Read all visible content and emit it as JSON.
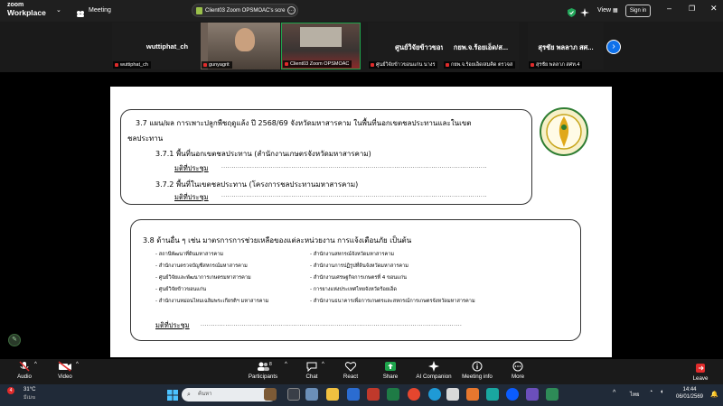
{
  "app": {
    "brand_top": "zoom",
    "brand_bottom": "Workplace"
  },
  "titlebar": {
    "meeting_label": "Meeting",
    "tab_label": "Client03 Zoom OPSMOAC's scre",
    "view_label": "View",
    "signin_label": "Sign in"
  },
  "gallery": {
    "tiles": [
      {
        "name": "wuttiphat_ch",
        "label": "wuttiphat_ch"
      },
      {
        "name": "",
        "label": "gunyagrit"
      },
      {
        "name": "",
        "label": "Client03 Zoom OPSMOAC"
      },
      {
        "name": "ศูนย์วิจัยข้าวขอน...",
        "label": "ศูนย์วิจัยข้าวขอนแก่น นางร"
      },
      {
        "name": "กยพ.จ.ร้อยเอ็ด/ส...",
        "label": "กยพ.จ.ร้อยเอ็ด/สมคิด ตรวจส"
      },
      {
        "name": "สุรชัย พลลาภ สศ...",
        "label": "สุรชัย พลลาภ สศท.4"
      }
    ]
  },
  "slide": {
    "box1": {
      "heading_line1": "3.7 แผน/ผล การเพาะปลูกพืชฤดูแล้ง ปี 2568/69 จังหวัดมหาสารคาม ในพื้นที่นอกเขตชลประทานและในเขต",
      "heading_line2": "ชลประทาน",
      "item1": "3.7.1 พื้นที่นอกเขตชลประทาน (สำนักงานเกษตรจังหวัดมหาสารคาม)",
      "item1_resolution": "มติที่ประชุม",
      "item2": "3.7.2 พื้นที่ในเขตชลประทาน (โครงการชลประทานมหาสารคาม)",
      "item2_resolution": "มติที่ประชุม",
      "dots": "................................................................................................................................."
    },
    "box2": {
      "heading": "3.8 ด้านอื่น ๆ เช่น มาตรการการช่วยเหลือของแต่ละหน่วยงาน การแจ้งเตือนภัย เป็นต้น",
      "left_items": [
        "- สถานีพัฒนาที่ดินมหาสารคาม",
        "- สำนักงานตรวจบัญชีสหกรณ์มหาสารคาม",
        "- ศูนย์วิจัยและพัฒนาการเกษตรมหาสารคาม",
        "- ศูนย์วิจัยข้าวขอนแก่น",
        "- สำนักงานหม่อนไหมเฉลิมพระเกียรติฯ มหาสารคาม"
      ],
      "right_items": [
        "- สำนักงานสหกรณ์จังหวัดมหาสารคาม",
        "- สำนักงานการปฏิรูปที่ดินจังหวัดมหาสารคาม",
        "- สำนักงานเศรษฐกิจการเกษตรที่ 4 ขอนแก่น",
        "- การยางแห่งประเทศไทยจังหวัดร้อยเอ็ด",
        "- สำนักงานธนาคารเพื่อการเกษตรและสหกรณ์การเกษตรจังหวัดมหาสารคาม"
      ],
      "resolution": "มติที่ประชุม",
      "dots": "..............................................................................................................................."
    }
  },
  "toolbar": {
    "audio": "Audio",
    "video": "Video",
    "participants": "Participants",
    "participants_count": "8",
    "chat": "Chat",
    "react": "React",
    "share": "Share",
    "ai_companion": "AI Companion",
    "meeting_info": "Meeting info",
    "more": "More",
    "leave": "Leave"
  },
  "taskbar": {
    "weather_temp": "31°C",
    "weather_desc": "มีเมฆ",
    "weather_badge": "4",
    "search_placeholder": "ค้นหา",
    "lang": "ไทย",
    "time": "14:44",
    "date": "06/01/2569"
  },
  "colors": {
    "share_green": "#1ea54c",
    "leave_red": "#e02b2b",
    "accent_blue": "#0e71eb"
  }
}
